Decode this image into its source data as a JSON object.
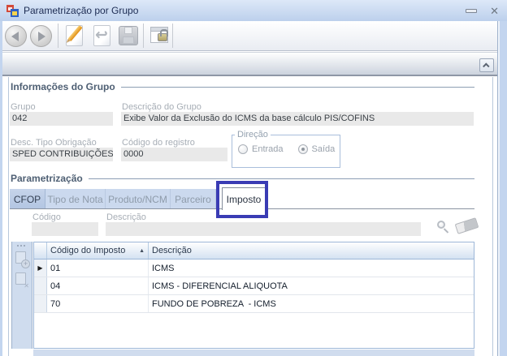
{
  "window": {
    "title": "Parametrização por Grupo"
  },
  "icons": {
    "app_icon": "overlapping-windows",
    "minimize_icon": "dash",
    "close_icon": "✕",
    "nav_previous_icon": "left-triangle-circle",
    "nav_next_icon": "right-triangle-circle",
    "edit_icon": "pencil-on-page",
    "undo_icon": "↩",
    "save_icon": "floppy-disk",
    "security_icon": "window-with-padlock",
    "collapse_icon": "chevron-up",
    "search_icon": "magnifier",
    "clear_filter_icon": "eraser",
    "add_row_icon": "page-plus",
    "delete_row_icon": "page-x",
    "drag_handle_icon": "dots",
    "sort_asc_icon": "▲",
    "row_indicator_icon": "▶"
  },
  "toolbar": {
    "buttons": [
      {
        "name": "previous",
        "enabled": false
      },
      {
        "name": "next",
        "enabled": false
      },
      {
        "name": "edit",
        "enabled": true
      },
      {
        "name": "undo",
        "enabled": false
      },
      {
        "name": "save",
        "enabled": false
      },
      {
        "name": "security",
        "enabled": true
      }
    ]
  },
  "group_info": {
    "section_title": "Informações do Grupo",
    "grupo": {
      "label": "Grupo",
      "value": "042"
    },
    "descricao_grupo": {
      "label": "Descrição do Grupo",
      "value": "Exibe Valor da Exclusão do ICMS da base cálculo PIS/COFINS"
    },
    "tipo_obrigacao": {
      "label": "Desc. Tipo Obrigação",
      "value": "SPED CONTRIBUIÇÕES"
    },
    "codigo_registro": {
      "label": "Código do registro",
      "value": "0000"
    },
    "direcao": {
      "label": "Direção",
      "options": [
        {
          "label": "Entrada",
          "selected": false
        },
        {
          "label": "Saída",
          "selected": true
        }
      ]
    }
  },
  "parametrizacao": {
    "section_title": "Parametrização",
    "tabs": [
      {
        "label": "CFOP",
        "state": "normal"
      },
      {
        "label": "Tipo de Nota",
        "state": "dimmed"
      },
      {
        "label": "Produto/NCM",
        "state": "dimmed"
      },
      {
        "label": "Parceiro",
        "state": "dimmed"
      },
      {
        "label": "Imposto",
        "state": "active",
        "highlighted": true
      }
    ],
    "filter": {
      "codigo_label": "Código",
      "codigo_value": "",
      "descricao_label": "Descrição",
      "descricao_value": ""
    },
    "grid": {
      "columns": [
        {
          "label": "Código do Imposto",
          "sort": "asc",
          "sort_glyph": "▲"
        },
        {
          "label": "Descrição",
          "sort": null
        }
      ],
      "rows": [
        {
          "codigo": "01",
          "descricao": "ICMS"
        },
        {
          "codigo": "04",
          "descricao": "ICMS - DIFERENCIAL ALIQUOTA"
        },
        {
          "codigo": "70",
          "descricao": "FUNDO DE POBREZA  - ICMS"
        }
      ],
      "selected_row_index": 0
    }
  },
  "colors": {
    "annotation_highlight": "#3a3cb4",
    "titlebar_top": "#dde8f8",
    "titlebar_bottom": "#bcd0ec",
    "window_border": "#c3d5ef",
    "readonly_field_bg": "#e9e9e9",
    "grid_header_bg": "#d4e2f2",
    "tab_active_bg": "#ffffff",
    "section_title_text": "#4e5f73"
  }
}
